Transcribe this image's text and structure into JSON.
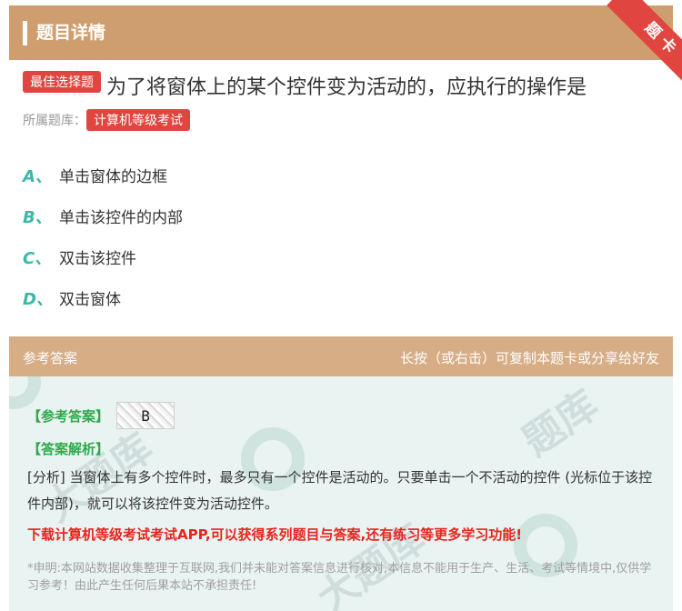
{
  "header": {
    "title": "题目详情",
    "ribbon_text": "题卡"
  },
  "question": {
    "type_badge": "最佳选择题",
    "text": "为了将窗体上的某个控件变为活动的，应执行的操作是",
    "bank_label": "所属题库：",
    "bank_name": "计算机等级考试"
  },
  "options": [
    {
      "letter": "A、",
      "text": "单击窗体的边框"
    },
    {
      "letter": "B、",
      "text": "单击该控件的内部"
    },
    {
      "letter": "C、",
      "text": "双击该控件"
    },
    {
      "letter": "D、",
      "text": "双击窗体"
    }
  ],
  "answer": {
    "head_left": "参考答案",
    "head_right": "长按（或右击）可复制本题卡或分享给好友",
    "ref_label": "【参考答案】",
    "ref_value": "B",
    "analysis_label": "【答案解析】",
    "analysis_text": "[分析] 当窗体上有多个控件时，最多只有一个控件是活动的。只要单击一个不活动的控件 (光标位于该控件内部)，就可以将该控件变为活动控件。",
    "promo": "下载计算机等级考试考试APP,可以获得系列题目与答案,还有练习等更多学习功能!",
    "disclaimer": "*申明:本网站数据收集整理于互联网,我们并未能对答案信息进行核对,本信息不能用于生产、生活、考试等情境中,仅供学习参考！由此产生任何后果本站不承担责任!"
  },
  "colors": {
    "header_bg": "#cf9e6e",
    "ribbon": "#e0463f",
    "badge": "#e0463f",
    "option_letter": "#3cb8a8",
    "answer_bg": "#e9f3f1",
    "answer_head": "#d7ad86",
    "green_label": "#2eaa4c",
    "promo": "#e8231d"
  }
}
